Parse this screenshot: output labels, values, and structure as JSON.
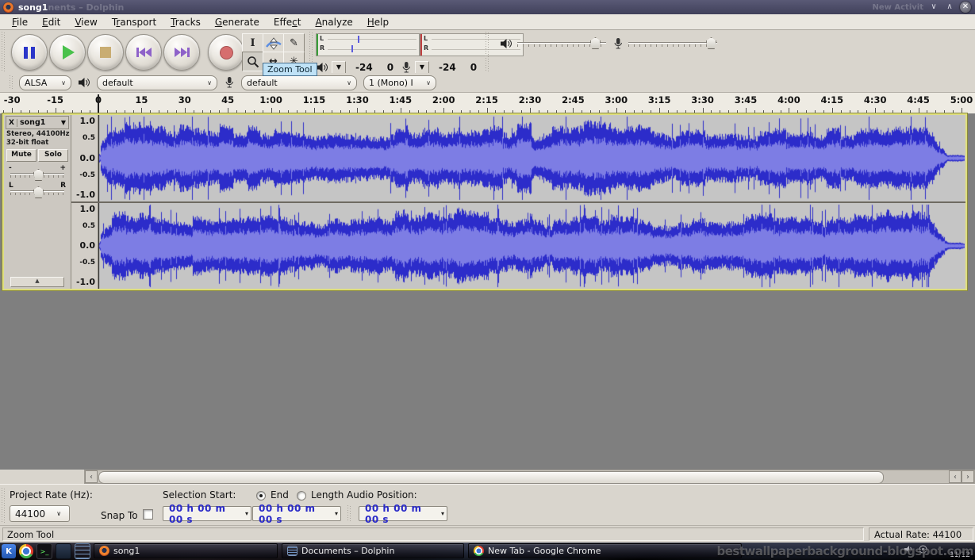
{
  "window": {
    "title": "song1",
    "ghost": "nents – Dolphin",
    "ghost2": "New Activit"
  },
  "menu": {
    "items": [
      {
        "label": "File",
        "u": 0
      },
      {
        "label": "Edit",
        "u": 0
      },
      {
        "label": "View",
        "u": 0
      },
      {
        "label": "Transport",
        "u": 1
      },
      {
        "label": "Tracks",
        "u": 0
      },
      {
        "label": "Generate",
        "u": 0
      },
      {
        "label": "Effect",
        "u": 4
      },
      {
        "label": "Analyze",
        "u": 0
      },
      {
        "label": "Help",
        "u": 0
      }
    ]
  },
  "transport": {
    "buttons": [
      "pause",
      "play",
      "stop",
      "skip-to-start",
      "skip-to-end",
      "record"
    ]
  },
  "tools": {
    "tooltip": "Zoom Tool",
    "buttons": [
      "selection",
      "envelope",
      "draw",
      "zoom",
      "time-shift",
      "multi"
    ]
  },
  "meters": {
    "channel_labels": [
      "L",
      "R"
    ],
    "scale_min": "-24",
    "scale_max": "0"
  },
  "device": {
    "host": "ALSA",
    "playback_device": "default",
    "recording_device": "default",
    "recording_channels": "1 (Mono) I"
  },
  "timeline": {
    "labels": [
      [
        "-30",
        -30
      ],
      [
        "-15",
        -15
      ],
      [
        "0",
        0
      ],
      [
        "15",
        15
      ],
      [
        "30",
        30
      ],
      [
        "45",
        45
      ],
      [
        "1:00",
        60
      ],
      [
        "1:15",
        75
      ],
      [
        "1:30",
        90
      ],
      [
        "1:45",
        105
      ],
      [
        "2:00",
        120
      ],
      [
        "2:15",
        135
      ],
      [
        "2:30",
        150
      ],
      [
        "2:45",
        165
      ],
      [
        "3:00",
        180
      ],
      [
        "3:15",
        195
      ],
      [
        "3:30",
        210
      ],
      [
        "3:45",
        225
      ],
      [
        "4:00",
        240
      ],
      [
        "4:15",
        255
      ],
      [
        "4:30",
        270
      ],
      [
        "4:45",
        285
      ],
      [
        "5:00",
        300
      ]
    ]
  },
  "track": {
    "close": "X",
    "name": "song1",
    "info_line1": "Stereo, 44100Hz",
    "info_line2": "32-bit float",
    "mute": "Mute",
    "solo": "Solo",
    "gain_min": "-",
    "gain_max": "+",
    "pan_left": "L",
    "pan_right": "R",
    "amp_labels": [
      "1.0",
      "0.5",
      "0.0",
      "-0.5",
      "-1.0"
    ]
  },
  "waveform": {
    "peak_color": "#2c2cca",
    "rms_color": "#7d7de4",
    "background": "#c5c5c5",
    "duration_seconds": 300,
    "channels": 2
  },
  "selection": {
    "project_rate_label": "Project Rate (Hz):",
    "project_rate": "44100",
    "snap_label": "Snap To",
    "start_label": "Selection Start:",
    "end_label": "End",
    "length_label": "Length",
    "audio_label": "Audio Position:",
    "start_value": "00 h 00 m 00 s",
    "end_value": "00 h 00 m 00 s",
    "audio_value": "00 h 00 m 00 s"
  },
  "status": {
    "message": "Zoom Tool",
    "actual_rate": "Actual Rate: 44100"
  },
  "taskbar": {
    "tasks": [
      {
        "icon": "audacity",
        "label": "song1"
      },
      {
        "icon": "dolphin",
        "label": "Documents – Dolphin"
      },
      {
        "icon": "chrome",
        "label": "New Tab - Google Chrome"
      }
    ],
    "clock_date": "11/12",
    "watermark": "bestwallpaperbackground-blogspot.com"
  }
}
